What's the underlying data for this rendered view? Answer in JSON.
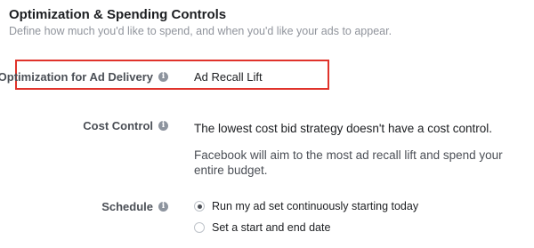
{
  "section": {
    "title": "Optimization & Spending Controls",
    "subtitle": "Define how much you'd like to spend, and when you'd like your ads to appear."
  },
  "optimization": {
    "label": "Optimization for Ad Delivery",
    "value": "Ad Recall Lift",
    "info_icon": "info-icon",
    "highlight_color": "#e0332b"
  },
  "cost_control": {
    "label": "Cost Control",
    "info_icon": "info-icon",
    "main_text": "The lowest cost bid strategy doesn't have a cost control.",
    "note_text": "Facebook will aim to the most ad recall lift and spend your entire budget."
  },
  "schedule": {
    "label": "Schedule",
    "info_icon": "info-icon",
    "options": [
      {
        "label": "Run my ad set continuously starting today",
        "selected": true
      },
      {
        "label": "Set a start and end date",
        "selected": false
      }
    ]
  }
}
